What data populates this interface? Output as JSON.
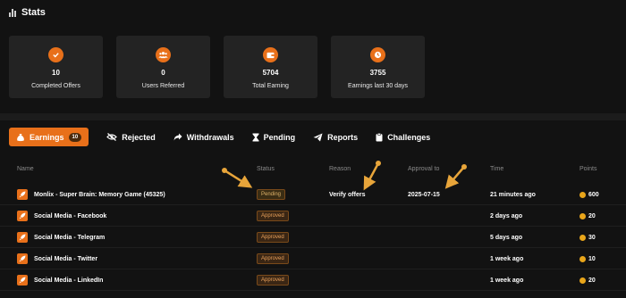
{
  "header": {
    "title": "Stats",
    "icon": "bar-chart-icon"
  },
  "stat_cards": [
    {
      "value": "10",
      "label": "Completed Offers",
      "icon": "check-circle-icon"
    },
    {
      "value": "0",
      "label": "Users Referred",
      "icon": "users-icon"
    },
    {
      "value": "5704",
      "label": "Total Earning",
      "icon": "wallet-icon"
    },
    {
      "value": "3755",
      "label": "Earnings last 30 days",
      "icon": "clock-icon"
    }
  ],
  "tabs": [
    {
      "label": "Earnings",
      "badge": "10",
      "icon": "money-bag-icon",
      "active": true
    },
    {
      "label": "Rejected",
      "icon": "eye-slash-icon"
    },
    {
      "label": "Withdrawals",
      "icon": "share-arrow-icon"
    },
    {
      "label": "Pending",
      "icon": "hourglass-icon"
    },
    {
      "label": "Reports",
      "icon": "paper-plane-icon"
    },
    {
      "label": "Challenges",
      "icon": "clipboard-icon"
    }
  ],
  "table": {
    "columns": [
      "Name",
      "Status",
      "Reason",
      "Approval to",
      "Time",
      "Points"
    ],
    "rows": [
      {
        "name": "Monlix - Super Brain: Memory Game (45325)",
        "status": "Pending",
        "reason": "Verify offers",
        "approval_to": "2025-07-15",
        "time": "21 minutes ago",
        "points": "600"
      },
      {
        "name": "Social Media - Facebook",
        "status": "Approved",
        "reason": "",
        "approval_to": "",
        "time": "2 days ago",
        "points": "20"
      },
      {
        "name": "Social Media - Telegram",
        "status": "Approved",
        "reason": "",
        "approval_to": "",
        "time": "5 days ago",
        "points": "30"
      },
      {
        "name": "Social Media - Twitter",
        "status": "Approved",
        "reason": "",
        "approval_to": "",
        "time": "1 week ago",
        "points": "10"
      },
      {
        "name": "Social Media - LinkedIn",
        "status": "Approved",
        "reason": "",
        "approval_to": "",
        "time": "1 week ago",
        "points": "20"
      }
    ]
  },
  "colors": {
    "accent": "#e8701a",
    "background": "#121212",
    "card": "#232323",
    "points_dot": "#e8a51a",
    "arrow": "#e8a53a"
  }
}
